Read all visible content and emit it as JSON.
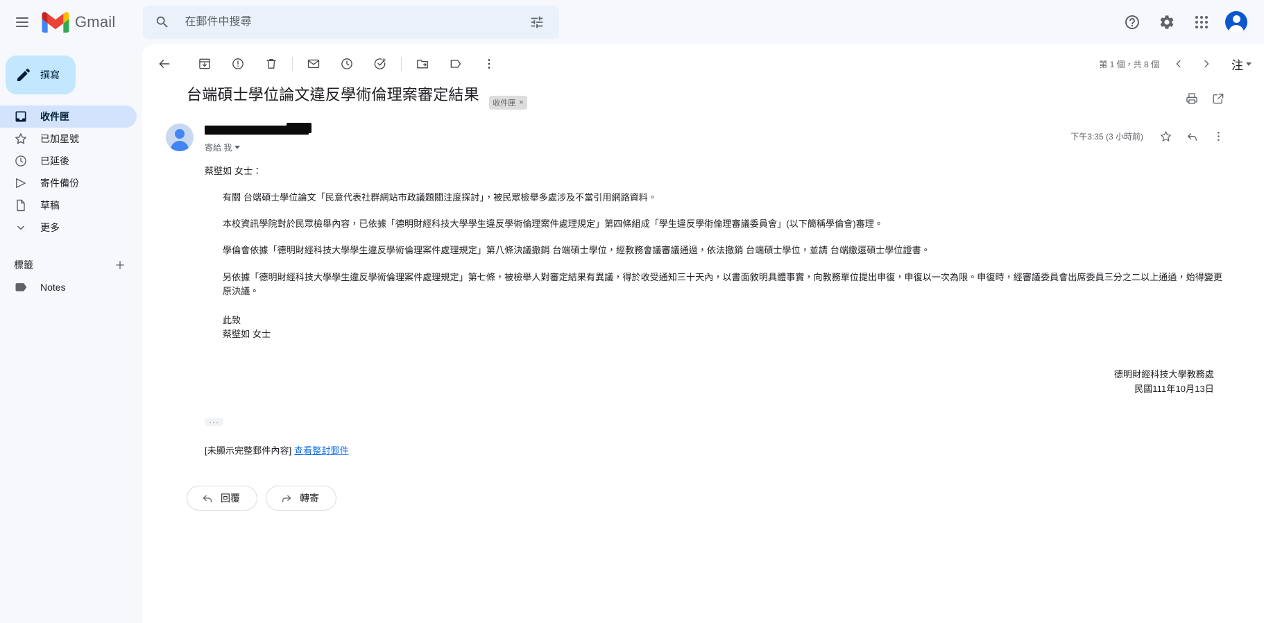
{
  "app": {
    "brand": "Gmail",
    "menu_icon": "hamburger-menu-icon",
    "logo_icon": "gmail-logo-icon"
  },
  "search": {
    "placeholder": "在郵件中搜尋",
    "search_icon": "search-icon",
    "filter_icon": "search-options-icon"
  },
  "topbar_right": {
    "help_icon": "help-icon",
    "settings_icon": "gear-icon",
    "apps_icon": "google-apps-grid-icon",
    "account_icon": "account-avatar-icon"
  },
  "sidebar": {
    "compose": {
      "label": "撰寫",
      "icon": "pencil-icon"
    },
    "items": [
      {
        "label": "收件匣",
        "icon": "inbox-icon",
        "active": true
      },
      {
        "label": "已加星號",
        "icon": "star-icon",
        "active": false
      },
      {
        "label": "已延後",
        "icon": "clock-icon",
        "active": false
      },
      {
        "label": "寄件備份",
        "icon": "send-icon",
        "active": false
      },
      {
        "label": "草稿",
        "icon": "document-icon",
        "active": false
      },
      {
        "label": "更多",
        "icon": "chevron-down-icon",
        "active": false
      }
    ],
    "labels_header": {
      "title": "標籤",
      "add_icon": "plus-icon"
    },
    "labels": [
      {
        "label": "Notes",
        "icon": "label-tag-icon"
      }
    ]
  },
  "toolbar": {
    "back": "back-arrow-icon",
    "archive": "archive-icon",
    "spam": "report-spam-icon",
    "delete": "trash-icon",
    "mark_unread": "mark-as-unread-icon",
    "snooze": "snooze-clock-icon",
    "add_task": "add-to-tasks-icon",
    "move_to": "move-to-folder-icon",
    "labels": "label-tag-icon",
    "more": "more-vertical-icon",
    "pagination": "第 1 個，共 8 個",
    "prev": "chevron-left-icon",
    "next": "chevron-right-icon",
    "zhu_label": "注"
  },
  "email": {
    "subject": "台端碩士學位論文違反學術倫理案審定結果",
    "label_chip": "收件匣",
    "chip_remove": "×",
    "print_icon": "print-icon",
    "popout_icon": "open-in-new-window-icon",
    "sender_redacted": true,
    "to_line": "寄給 我",
    "timestamp": "下午3:35 (3 小時前)",
    "star_icon": "star-outline-icon",
    "reply_icon": "reply-arrow-icon",
    "more_icon": "more-vertical-icon",
    "salutation": "蔡壁如 女士：",
    "paragraphs": [
      "有關 台端碩士學位論文「民意代表社群網站市政議題關注度探討」，被民眾檢舉多處涉及不當引用網路資料。",
      "本校資訊學院對於民眾檢舉內容，已依據「德明財經科技大學學生違反學術倫理案件處理規定」第四條組成「學生違反學術倫理審議委員會」(以下簡稱學倫會)審理。",
      "學倫會依據「德明財經科技大學學生違反學術倫理案件處理規定」第八條決議撤銷 台端碩士學位，經教務會議審議通過，依法撤銷 台端碩士學位，並請 台端繳還碩士學位證書。",
      "另依據「德明財經科技大學學生違反學術倫理案件處理規定」第七條，被檢舉人對審定結果有異議，得於收受通知三十天內，以書面敘明具體事實，向教務單位提出申復，申復以一次為限。申復時，經審議委員會出席委員三分之二以上通過，始得變更原決議。"
    ],
    "closing": "此致",
    "closing_name": "蔡壁如 女士",
    "signature_org": "德明財經科技大學教務處",
    "signature_date": "民國111年10月13日",
    "expand_ellipsis": "···",
    "truncated_notice": "[未顯示完整郵件內容]",
    "view_full_link": "查看整封郵件",
    "reply_button": "回覆",
    "forward_button": "轉寄"
  },
  "colors": {
    "accent_blue": "#0b57d0",
    "compose_bg": "#c2e7ff",
    "active_nav_bg": "#d3e3fd",
    "search_bg": "#eaf1fb",
    "page_bg": "#f6f8fc",
    "link": "#1a73e8"
  }
}
